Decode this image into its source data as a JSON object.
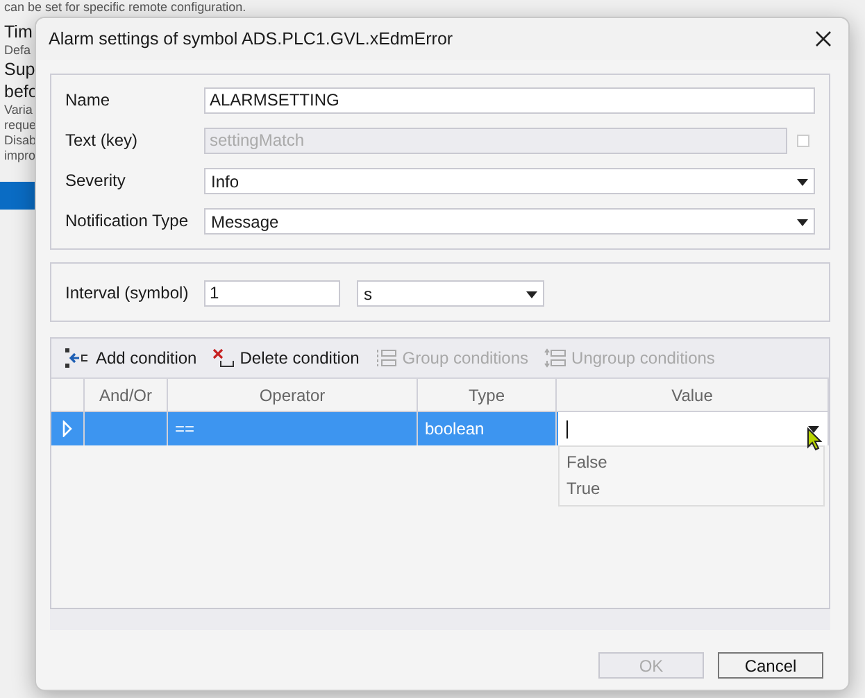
{
  "background_page": {
    "texts": [
      {
        "kind": "note",
        "text": "can be set for specific remote configuration."
      },
      {
        "kind": "heading",
        "text": "Tim"
      },
      {
        "kind": "note",
        "text": "Defa"
      },
      {
        "kind": "heading",
        "text": "Sup"
      },
      {
        "kind": "heading",
        "text": "befo"
      },
      {
        "kind": "note",
        "text": "Varia"
      },
      {
        "kind": "note",
        "text": "reque"
      },
      {
        "kind": "note",
        "text": "Disab"
      },
      {
        "kind": "note",
        "text": "impro"
      },
      {
        "kind": "bar"
      }
    ]
  },
  "dialog": {
    "title": "Alarm settings of symbol ADS.PLC1.GVL.xEdmError",
    "fields": [
      {
        "kind": "text",
        "label": "Name",
        "value": "ALARMSETTING"
      },
      {
        "kind": "readonly",
        "label": "Text (key)",
        "value": "settingMatch",
        "checked": false
      },
      {
        "kind": "dropdown",
        "label": "Severity",
        "value": "Info"
      },
      {
        "kind": "dropdown",
        "label": "Notification Type",
        "value": "Message"
      }
    ],
    "interval": {
      "label": "Interval (symbol)",
      "value": "1",
      "unit": "s"
    },
    "toolbar": [
      {
        "kind": "add",
        "label": "Add condition",
        "disabled": false
      },
      {
        "kind": "delete",
        "label": "Delete condition",
        "disabled": false
      },
      {
        "kind": "group",
        "label": "Group conditions",
        "disabled": true
      },
      {
        "kind": "ungroup",
        "label": "Ungroup conditions",
        "disabled": true
      }
    ],
    "table": {
      "columns": [
        "And/Or",
        "Operator",
        "Type",
        "Value"
      ],
      "rows": [
        {
          "selected": true,
          "operator": "==",
          "type": "boolean",
          "value_editor": {
            "open": true,
            "options": [
              "False",
              "True"
            ]
          }
        }
      ]
    },
    "buttons": [
      {
        "label": "OK",
        "disabled": true
      },
      {
        "label": "Cancel",
        "disabled": false
      }
    ]
  }
}
